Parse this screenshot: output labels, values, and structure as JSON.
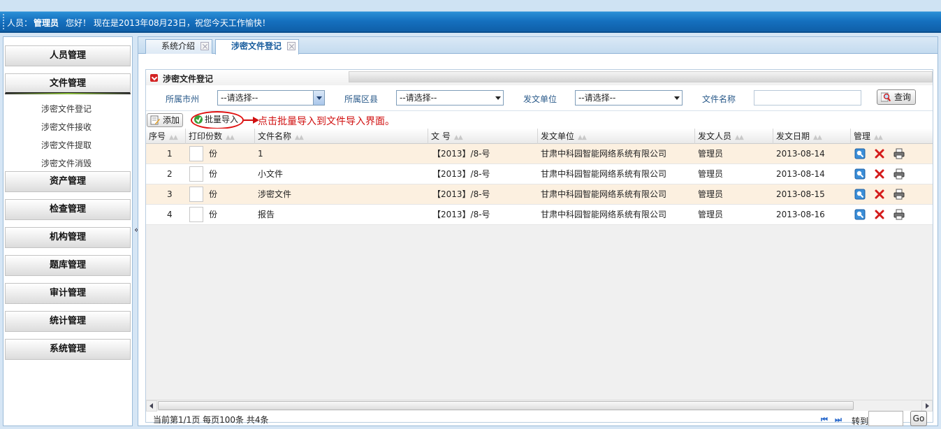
{
  "header": {
    "user_label": "人员：",
    "user_name": "管理员",
    "greeting": "您好！ 现在是2013年08月23日，祝您今天工作愉快！"
  },
  "sidebar": {
    "menus": [
      {
        "label": "人员管理"
      },
      {
        "label": "文件管理"
      },
      {
        "label": "资产管理"
      },
      {
        "label": "检查管理"
      },
      {
        "label": "机构管理"
      },
      {
        "label": "题库管理"
      },
      {
        "label": "审计管理"
      },
      {
        "label": "统计管理"
      },
      {
        "label": "系统管理"
      }
    ],
    "sub_items": [
      "涉密文件登记",
      "涉密文件接收",
      "涉密文件提取",
      "涉密文件消毁"
    ],
    "collapse_glyph": "«"
  },
  "tabs": [
    {
      "label": "系统介绍"
    },
    {
      "label": "涉密文件登记"
    }
  ],
  "panel": {
    "title": "涉密文件登记",
    "filters": {
      "city_label": "所属市州",
      "city_value": "--请选择--",
      "county_label": "所属区县",
      "county_value": "--请选择--",
      "unit_label": "发文单位",
      "unit_value": "--请选择--",
      "filename_label": "文件名称",
      "filename_value": "",
      "query_label": "查询"
    },
    "toolbar": {
      "add_label": "添加",
      "batch_import_label": "批量导入",
      "annotation": "点击批量导入到文件导入界面。"
    },
    "columns": [
      "序号",
      "打印份数",
      "文件名称",
      "文 号",
      "发文单位",
      "发文人员",
      "发文日期",
      "管理"
    ],
    "copies_unit": "份",
    "rows": [
      {
        "no": "1",
        "name": "1",
        "doc_no": "【2013】/8-号",
        "unit": "甘肃中科园智能网络系统有限公司",
        "person": "管理员",
        "date": "2013-08-14"
      },
      {
        "no": "2",
        "name": "小文件",
        "doc_no": "【2013】/8-号",
        "unit": "甘肃中科园智能网络系统有限公司",
        "person": "管理员",
        "date": "2013-08-14"
      },
      {
        "no": "3",
        "name": "涉密文件",
        "doc_no": "【2013】/8-号",
        "unit": "甘肃中科园智能网络系统有限公司",
        "person": "管理员",
        "date": "2013-08-15"
      },
      {
        "no": "4",
        "name": "报告",
        "doc_no": "【2013】/8-号",
        "unit": "甘肃中科园智能网络系统有限公司",
        "person": "管理员",
        "date": "2013-08-16"
      }
    ],
    "pager": {
      "info": "当前第1/1页 每页100条 共4条",
      "goto_label": "转到",
      "goto_value": "",
      "go_label": "Go"
    }
  },
  "colors": {
    "header_blue": "#1570bf",
    "odd_row": "#fcf0e0",
    "annotation_red": "#d01010",
    "link_blue": "#2a5a8a"
  }
}
